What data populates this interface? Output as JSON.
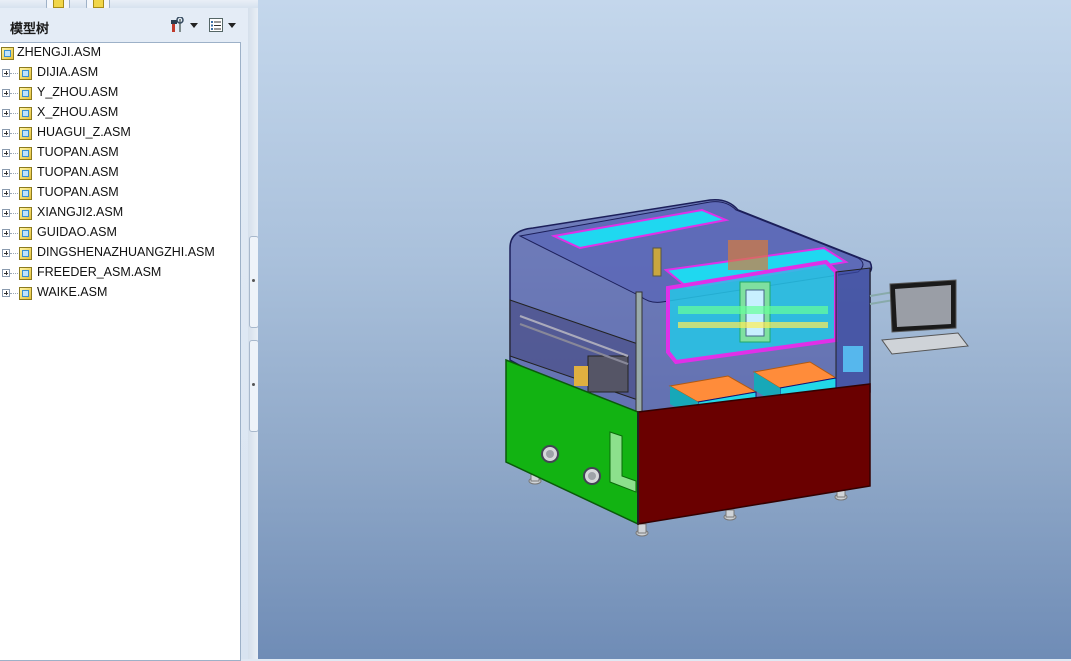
{
  "panel": {
    "title": "模型树",
    "settings_icon": "tools-icon",
    "show_icon": "tree-columns-icon"
  },
  "tree": {
    "root": "ZHENGJI.ASM",
    "items": [
      {
        "label": "DIJIA.ASM"
      },
      {
        "label": "Y_ZHOU.ASM"
      },
      {
        "label": "X_ZHOU.ASM"
      },
      {
        "label": "HUAGUI_Z.ASM"
      },
      {
        "label": "TUOPAN.ASM"
      },
      {
        "label": "TUOPAN.ASM"
      },
      {
        "label": "TUOPAN.ASM"
      },
      {
        "label": "XIANGJI2.ASM"
      },
      {
        "label": "GUIDAO.ASM"
      },
      {
        "label": "DINGSHENAZHUANGZHI.ASM"
      },
      {
        "label": "FREEDER_ASM.ASM"
      },
      {
        "label": "WAIKE.ASM"
      }
    ]
  },
  "colors": {
    "viewport_top": "#c4d7ec",
    "viewport_bottom": "#6f8cb6",
    "machine_green": "#12b312",
    "machine_maroon": "#6a0000",
    "accent_cyan": "#1fd8f0",
    "accent_magenta": "#e030e8"
  }
}
